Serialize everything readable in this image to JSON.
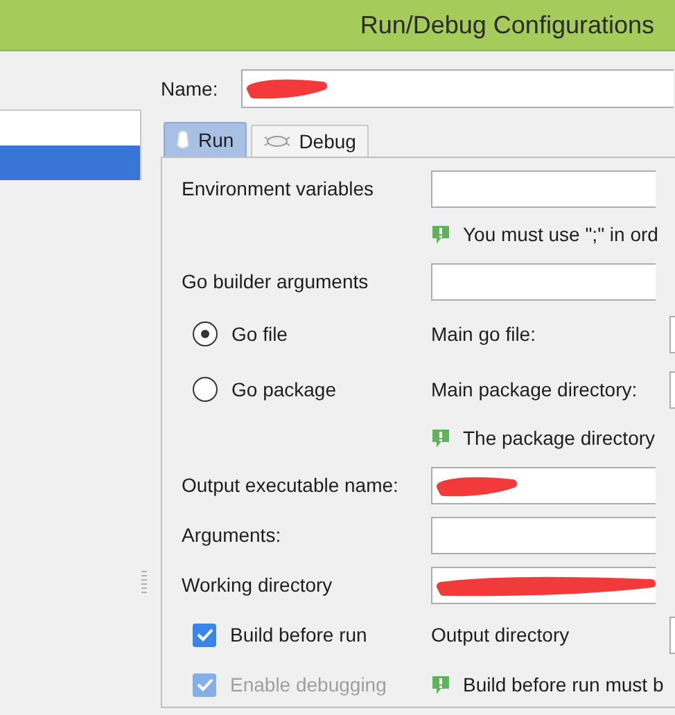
{
  "window": {
    "title": "Run/Debug Configurations"
  },
  "sidebar": {
    "items": [
      {
        "selected": false
      },
      {
        "selected": true
      }
    ]
  },
  "name_field": {
    "label": "Name:",
    "redacted": true
  },
  "tabs": [
    {
      "label": "Run",
      "selected": true
    },
    {
      "label": "Debug",
      "selected": false
    }
  ],
  "rows": [
    {
      "kind": "field",
      "label": "Environment variables",
      "redacted": false
    },
    {
      "kind": "note",
      "text": "You must use \";\" in ord"
    },
    {
      "kind": "field",
      "label": "Go builder arguments",
      "redacted": false
    },
    {
      "kind": "radio",
      "label": "Go file",
      "selected": true,
      "side_label": "Main go file:"
    },
    {
      "kind": "radio",
      "label": "Go package",
      "selected": false,
      "side_label": "Main package directory:"
    },
    {
      "kind": "note",
      "text": "The package directory"
    },
    {
      "kind": "field",
      "label": "Output executable name:",
      "redacted": true
    },
    {
      "kind": "field",
      "label": "Arguments:",
      "redacted": false
    },
    {
      "kind": "field",
      "label": "Working directory",
      "redacted": true
    },
    {
      "kind": "check",
      "label": "Build before run",
      "checked": true,
      "disabled": false,
      "side_label": "Output directory"
    },
    {
      "kind": "check",
      "label": "Enable debugging",
      "checked": true,
      "disabled": true,
      "side_note": "Build before run must b"
    }
  ]
}
